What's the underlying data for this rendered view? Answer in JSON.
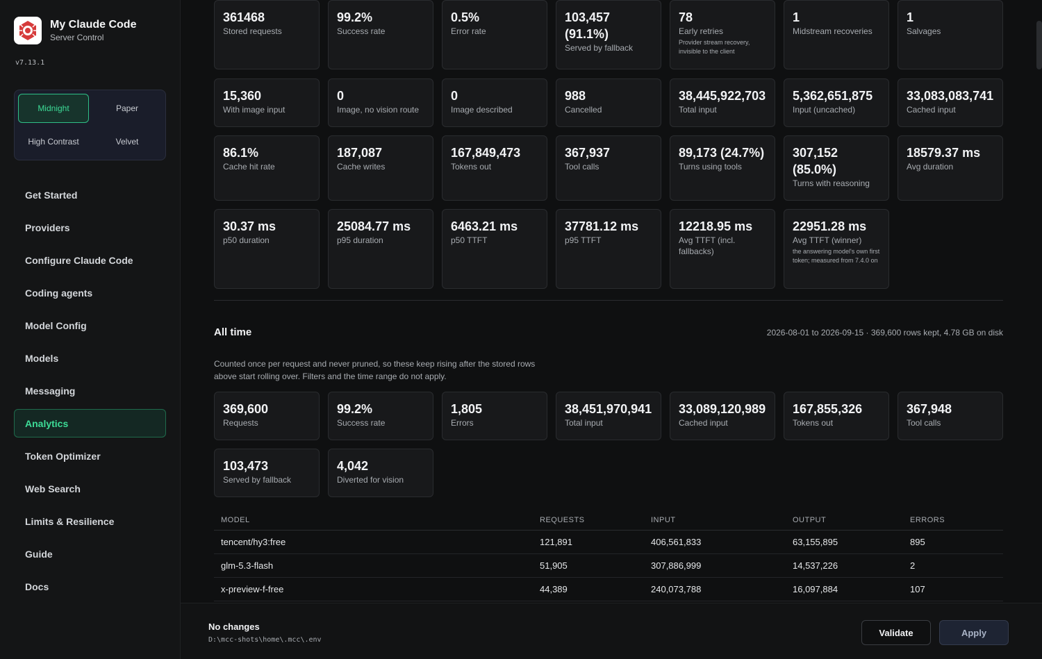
{
  "app": {
    "title": "My Claude Code",
    "subtitle": "Server Control",
    "version": "v7.13.1"
  },
  "themes": [
    "Midnight",
    "Paper",
    "High Contrast",
    "Velvet"
  ],
  "nav": [
    "Get Started",
    "Providers",
    "Configure Claude Code",
    "Coding agents",
    "Model Config",
    "Models",
    "Messaging",
    "Analytics",
    "Token Optimizer",
    "Web Search",
    "Limits & Resilience",
    "Guide",
    "Docs"
  ],
  "stats": [
    {
      "value": "361468",
      "label": "Stored requests"
    },
    {
      "value": "99.2%",
      "label": "Success rate"
    },
    {
      "value": "0.5%",
      "label": "Error rate"
    },
    {
      "value": "103,457 (91.1%)",
      "label": "Served by fallback"
    },
    {
      "value": "78",
      "label": "Early retries",
      "note": "Provider stream recovery, invisible to the client"
    },
    {
      "value": "1",
      "label": "Midstream recoveries"
    },
    {
      "value": "1",
      "label": "Salvages"
    },
    {
      "value": "15,360",
      "label": "With image input"
    },
    {
      "value": "0",
      "label": "Image, no vision route"
    },
    {
      "value": "0",
      "label": "Image described"
    },
    {
      "value": "988",
      "label": "Cancelled"
    },
    {
      "value": "38,445,922,703",
      "label": "Total input"
    },
    {
      "value": "5,362,651,875",
      "label": "Input (uncached)"
    },
    {
      "value": "33,083,083,741",
      "label": "Cached input"
    },
    {
      "value": "86.1%",
      "label": "Cache hit rate"
    },
    {
      "value": "187,087",
      "label": "Cache writes"
    },
    {
      "value": "167,849,473",
      "label": "Tokens out"
    },
    {
      "value": "367,937",
      "label": "Tool calls"
    },
    {
      "value": "89,173 (24.7%)",
      "label": "Turns using tools"
    },
    {
      "value": "307,152 (85.0%)",
      "label": "Turns with reasoning"
    },
    {
      "value": "18579.37 ms",
      "label": "Avg duration"
    },
    {
      "value": "30.37 ms",
      "label": "p50 duration"
    },
    {
      "value": "25084.77 ms",
      "label": "p95 duration"
    },
    {
      "value": "6463.21 ms",
      "label": "p50 TTFT"
    },
    {
      "value": "37781.12 ms",
      "label": "p95 TTFT"
    },
    {
      "value": "12218.95 ms",
      "label": "Avg TTFT (incl. fallbacks)"
    },
    {
      "value": "22951.28 ms",
      "label": "Avg TTFT (winner)",
      "note": "the answering model's own first token; measured from 7.4.0 on"
    }
  ],
  "all_time": {
    "title": "All time",
    "meta": "2026-08-01 to 2026-09-15 · 369,600 rows kept, 4.78 GB on disk",
    "description": "Counted once per request and never pruned, so these keep rising after the stored rows above start rolling over. Filters and the time range do not apply.",
    "stats": [
      {
        "value": "369,600",
        "label": "Requests"
      },
      {
        "value": "99.2%",
        "label": "Success rate"
      },
      {
        "value": "1,805",
        "label": "Errors"
      },
      {
        "value": "38,451,970,941",
        "label": "Total input"
      },
      {
        "value": "33,089,120,989",
        "label": "Cached input"
      },
      {
        "value": "167,855,326",
        "label": "Tokens out"
      },
      {
        "value": "367,948",
        "label": "Tool calls"
      },
      {
        "value": "103,473",
        "label": "Served by fallback"
      },
      {
        "value": "4,042",
        "label": "Diverted for vision"
      }
    ]
  },
  "table": {
    "headers": [
      "MODEL",
      "REQUESTS",
      "INPUT",
      "OUTPUT",
      "ERRORS"
    ],
    "rows": [
      [
        "tencent/hy3:free",
        "121,891",
        "406,561,833",
        "63,155,895",
        "895"
      ],
      [
        "glm-5.3-flash",
        "51,905",
        "307,886,999",
        "14,537,226",
        "2"
      ],
      [
        "x-preview-f-free",
        "44,389",
        "240,073,788",
        "16,097,884",
        "107"
      ]
    ]
  },
  "footer": {
    "status": "No changes",
    "path": "D:\\mcc-shots\\home\\.mcc\\.env",
    "validate": "Validate",
    "apply": "Apply"
  }
}
